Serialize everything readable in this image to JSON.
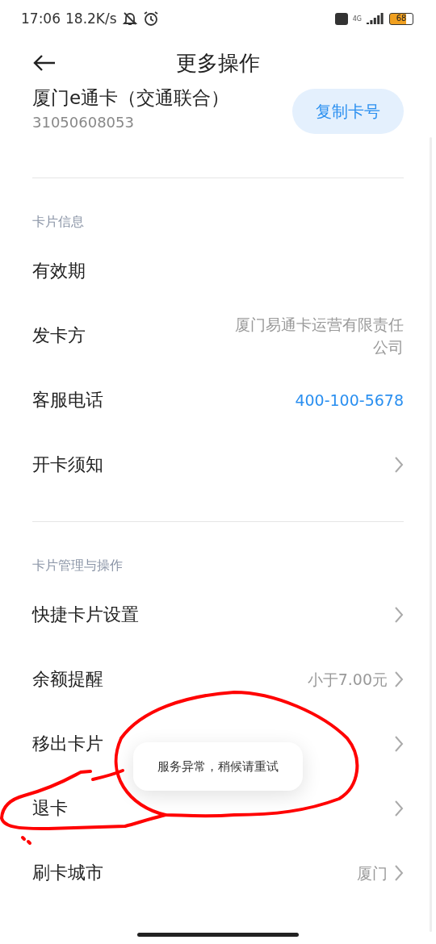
{
  "status_bar": {
    "time": "17:06",
    "speed": "18.2K/s",
    "network": "4G",
    "battery": "68"
  },
  "header": {
    "title": "更多操作"
  },
  "card": {
    "name": "厦门e通卡（交通联合）",
    "number": "31050608053",
    "copy_button": "复制卡号"
  },
  "sections": [
    {
      "title": "卡片信息",
      "rows": [
        {
          "label": "有效期",
          "kind": "plain",
          "chevron": false
        },
        {
          "label": "发卡方",
          "kind": "value",
          "value": "厦门易通卡运营有限责任公司",
          "chevron": false
        },
        {
          "label": "客服电话",
          "kind": "link",
          "value": "400-100-5678",
          "chevron": false
        },
        {
          "label": "开卡须知",
          "kind": "plain",
          "chevron": true
        }
      ]
    },
    {
      "title": "卡片管理与操作",
      "rows": [
        {
          "label": "快捷卡片设置",
          "kind": "plain",
          "chevron": true
        },
        {
          "label": "余额提醒",
          "kind": "value",
          "value": "小于7.00元",
          "chevron": true
        },
        {
          "label": "移出卡片",
          "kind": "plain",
          "chevron": true
        },
        {
          "label": "退卡",
          "kind": "plain",
          "chevron": true
        },
        {
          "label": "刷卡城市",
          "kind": "value",
          "value": "厦门",
          "chevron": true
        }
      ]
    }
  ],
  "toast": {
    "message": "服务异常，稍候请重试"
  }
}
